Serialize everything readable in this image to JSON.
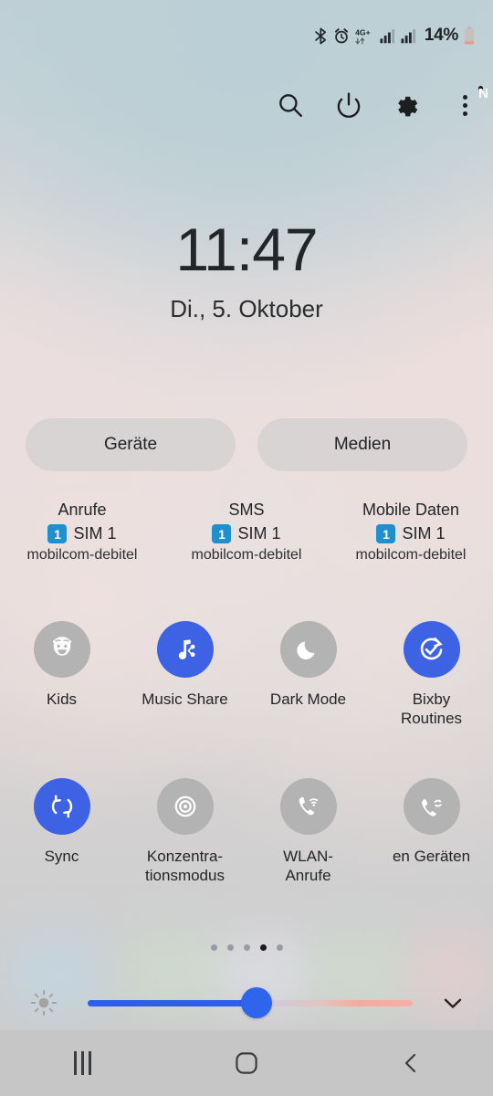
{
  "statusbar": {
    "icons": [
      "bluetooth-icon",
      "alarm-icon",
      "network-4g-plus-icon",
      "signal-sim1-icon",
      "signal-sim2-icon"
    ],
    "network_label": "4G+",
    "battery_percent": "14%"
  },
  "header": {
    "search_label": "Suchen",
    "power_label": "Ein/Aus",
    "settings_label": "Einstellungen",
    "more_label": "Mehr",
    "badge_letter": "N",
    "badge_color": "#f57c1f"
  },
  "clock": {
    "time": "11:47",
    "date": "Di., 5. Oktober"
  },
  "pills": [
    {
      "label": "Geräte"
    },
    {
      "label": "Medien"
    }
  ],
  "sim_info": [
    {
      "title": "Anrufe",
      "sim_badge": "1",
      "sim_label": "SIM 1",
      "carrier": "mobilcom-debitel"
    },
    {
      "title": "SMS",
      "sim_badge": "1",
      "sim_label": "SIM 1",
      "carrier": "mobilcom-debitel"
    },
    {
      "title": "Mobile Daten",
      "sim_badge": "1",
      "sim_label": "SIM 1",
      "carrier": "mobilcom-debitel"
    }
  ],
  "toggles_row1": [
    {
      "label": "Kids",
      "icon": "kids-face-icon",
      "state": "off"
    },
    {
      "label": "Music Share",
      "icon": "music-share-icon",
      "state": "on"
    },
    {
      "label": "Dark Mode",
      "icon": "moon-icon",
      "state": "off"
    },
    {
      "label": "Bixby\nRoutines",
      "icon": "bixby-routines-icon",
      "state": "on"
    }
  ],
  "toggles_row2": [
    {
      "label": "Sync",
      "icon": "sync-icon",
      "state": "on"
    },
    {
      "label": "Konzentra-\ntionsmodus",
      "icon": "focus-target-icon",
      "state": "off"
    },
    {
      "label": "WLAN-\nAnrufe",
      "icon": "wifi-calling-icon",
      "state": "off"
    },
    {
      "label": "en Geräten",
      "icon": "call-on-other-devices-icon",
      "state": "off"
    }
  ],
  "pager": {
    "total": 5,
    "active_index": 4
  },
  "brightness": {
    "icon": "brightness-icon",
    "value_percent": 52,
    "expand_icon": "chevron-down-icon"
  },
  "navbar": [
    {
      "label": "Letzte Apps",
      "icon": "recents-icon"
    },
    {
      "label": "Startseite",
      "icon": "home-icon"
    },
    {
      "label": "Zurück",
      "icon": "back-icon"
    }
  ],
  "colors": {
    "accent_blue": "#3d63e4",
    "toggle_off_gray": "#b3b3b3",
    "sim_badge_blue": "#1f8fd0",
    "badge_orange": "#f57c1f"
  }
}
